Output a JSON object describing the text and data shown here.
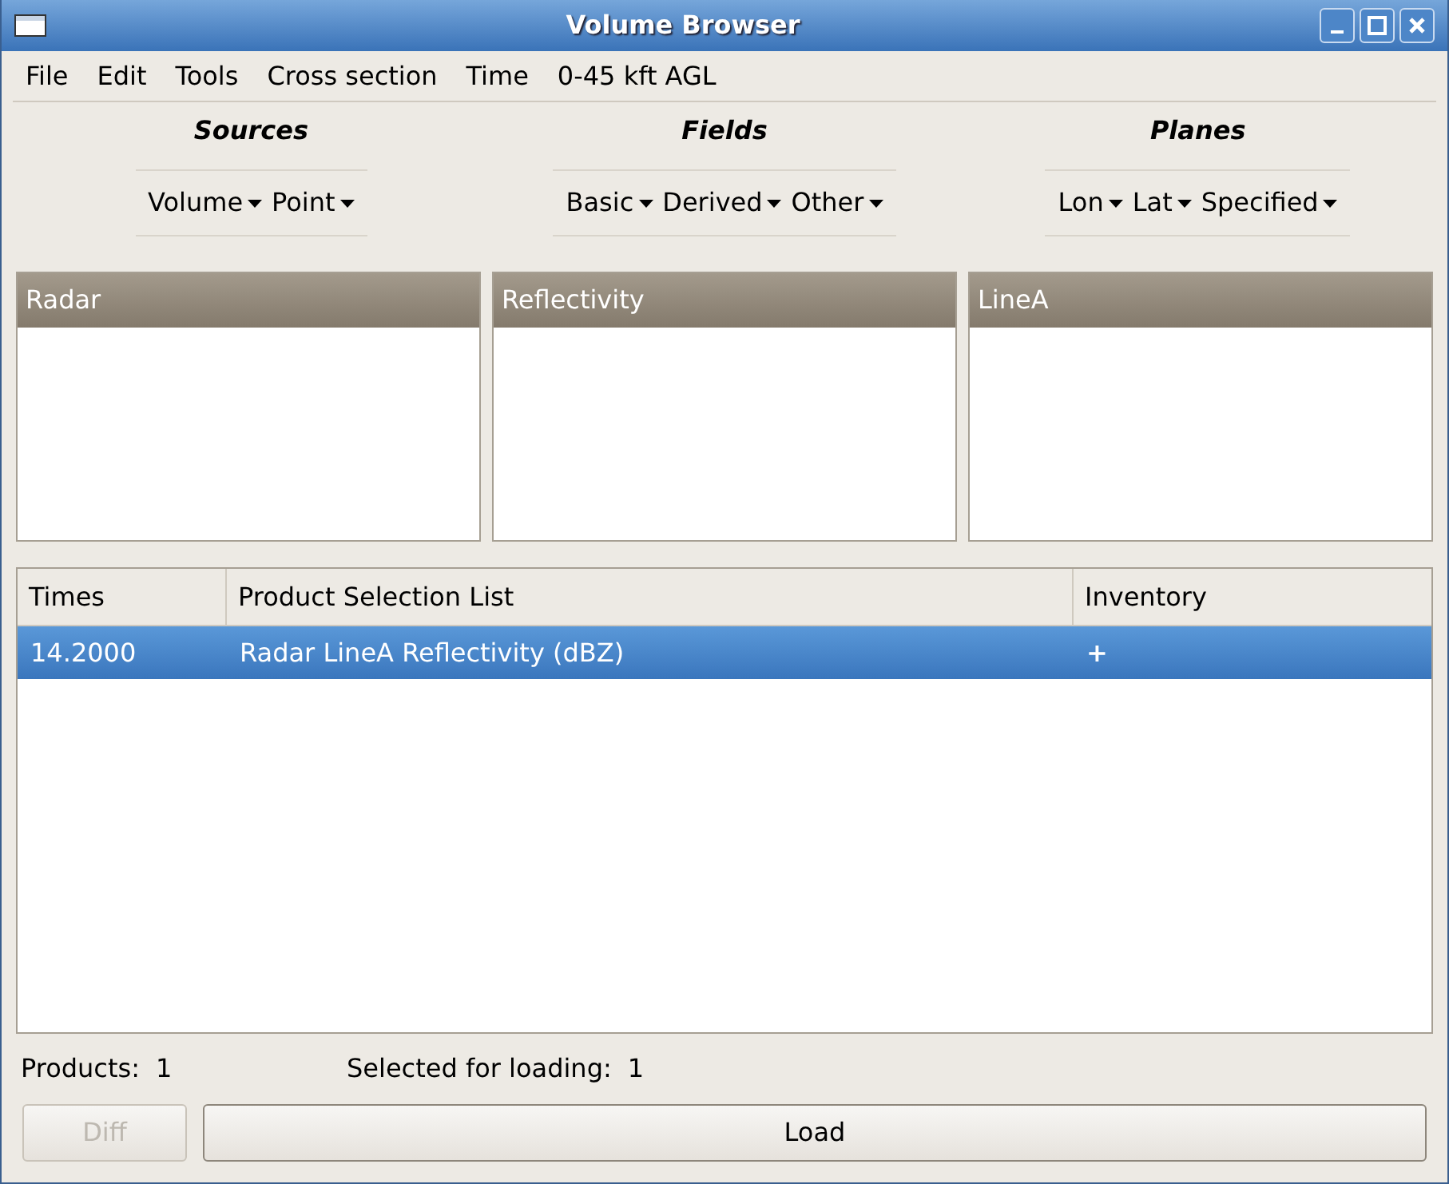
{
  "window": {
    "title": "Volume Browser"
  },
  "menu": [
    "File",
    "Edit",
    "Tools",
    "Cross section",
    "Time",
    "0-45 kft AGL"
  ],
  "groups": [
    {
      "title": "Sources",
      "menus": [
        "Volume",
        "Point"
      ]
    },
    {
      "title": "Fields",
      "menus": [
        "Basic",
        "Derived",
        "Other"
      ]
    },
    {
      "title": "Planes",
      "menus": [
        "Lon",
        "Lat",
        "Specified"
      ]
    }
  ],
  "lists": [
    {
      "header": "Radar"
    },
    {
      "header": "Reflectivity"
    },
    {
      "header": "LineA"
    }
  ],
  "table": {
    "columns": [
      "Times",
      "Product Selection List",
      "Inventory"
    ],
    "rows": [
      {
        "cells": [
          "14.2000",
          "Radar LineA Reflectivity (dBZ)",
          "+"
        ],
        "selected": true
      }
    ]
  },
  "status": [
    {
      "label": "Products:",
      "value": "1"
    },
    {
      "label": "Selected for loading:",
      "value": "1"
    }
  ],
  "buttons": [
    {
      "label": "Diff",
      "disabled": true
    },
    {
      "label": "Load",
      "disabled": false
    }
  ]
}
